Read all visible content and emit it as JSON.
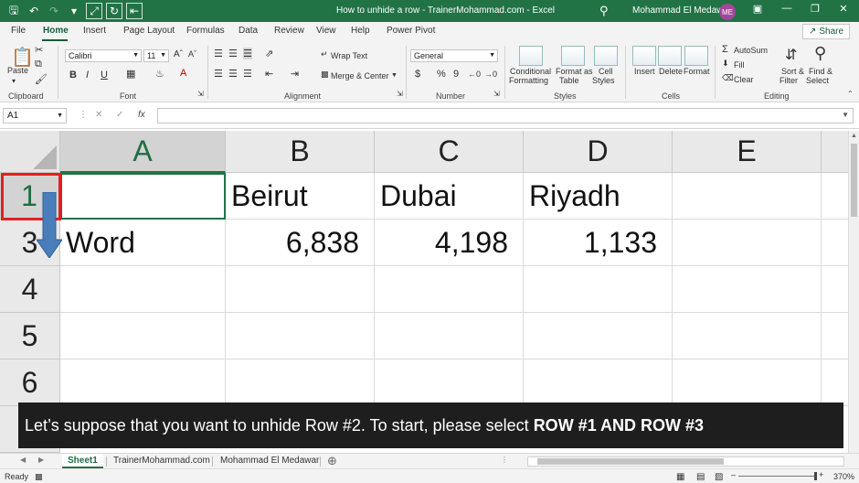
{
  "title_bar": {
    "title": "How to unhide a row - TrainerMohammad.com  -  Excel",
    "user": "Mohammad El Medawar",
    "avatar_initials": "ME",
    "icons": [
      "save-icon",
      "undo-icon",
      "redo-icon",
      "customize-icon",
      "fullscreen-icon",
      "refresh-icon",
      "back-icon",
      "search-icon",
      "ribbon-display-icon",
      "minimize-icon",
      "restore-icon",
      "close-icon"
    ]
  },
  "ribbon_tabs": [
    "File",
    "Home",
    "Insert",
    "Page Layout",
    "Formulas",
    "Data",
    "Review",
    "View",
    "Help",
    "Power Pivot"
  ],
  "share_label": "Share",
  "ribbon": {
    "clipboard": {
      "paste": "Paste",
      "label": "Clipboard"
    },
    "font": {
      "name": "Calibri",
      "size": "11",
      "bold": "B",
      "italic": "I",
      "underline": "U",
      "font_color": "A",
      "label": "Font"
    },
    "alignment": {
      "wrap": "Wrap Text",
      "merge": "Merge & Center",
      "label": "Alignment"
    },
    "number": {
      "format": "General",
      "currency": "$",
      "percent": "%",
      "comma": "9",
      "label": "Number"
    },
    "styles": {
      "conditional": "Conditional",
      "conditional2": "Formatting",
      "format_as": "Format as",
      "format_as2": "Table",
      "cell": "Cell",
      "cell2": "Styles",
      "label": "Styles"
    },
    "cells": {
      "insert": "Insert",
      "delete": "Delete",
      "format": "Format",
      "label": "Cells"
    },
    "editing": {
      "autosum": "AutoSum",
      "fill": "Fill",
      "clear": "Clear",
      "sort": "Sort &",
      "sort2": "Filter",
      "find": "Find &",
      "find2": "Select",
      "label": "Editing"
    }
  },
  "formula_bar": {
    "name_box": "A1",
    "fx": "fx",
    "value": ""
  },
  "columns": [
    "A",
    "B",
    "C",
    "D",
    "E"
  ],
  "rows": [
    {
      "header": "1",
      "cells": [
        "",
        "Beirut",
        "Dubai",
        "Riyadh",
        ""
      ]
    },
    {
      "header": "3",
      "cells": [
        "Word",
        "6,838",
        "4,198",
        "1,133",
        ""
      ]
    },
    {
      "header": "4",
      "cells": [
        "",
        "",
        "",
        "",
        ""
      ]
    },
    {
      "header": "5",
      "cells": [
        "",
        "",
        "",
        "",
        ""
      ]
    },
    {
      "header": "6",
      "cells": [
        "",
        "",
        "",
        "",
        ""
      ]
    }
  ],
  "caption": {
    "text": "Let’s suppose that you want to unhide Row #2. To start, please select",
    "bold": "ROW #1 AND ROW #3"
  },
  "sheets": [
    "Sheet1",
    "TrainerMohammad.com",
    "Mohammad El Medawar"
  ],
  "status": {
    "ready": "Ready",
    "zoom": "370%"
  },
  "colors": {
    "accent": "#217346",
    "highlight": "#e02020",
    "arrow": "#4a7ebb"
  }
}
